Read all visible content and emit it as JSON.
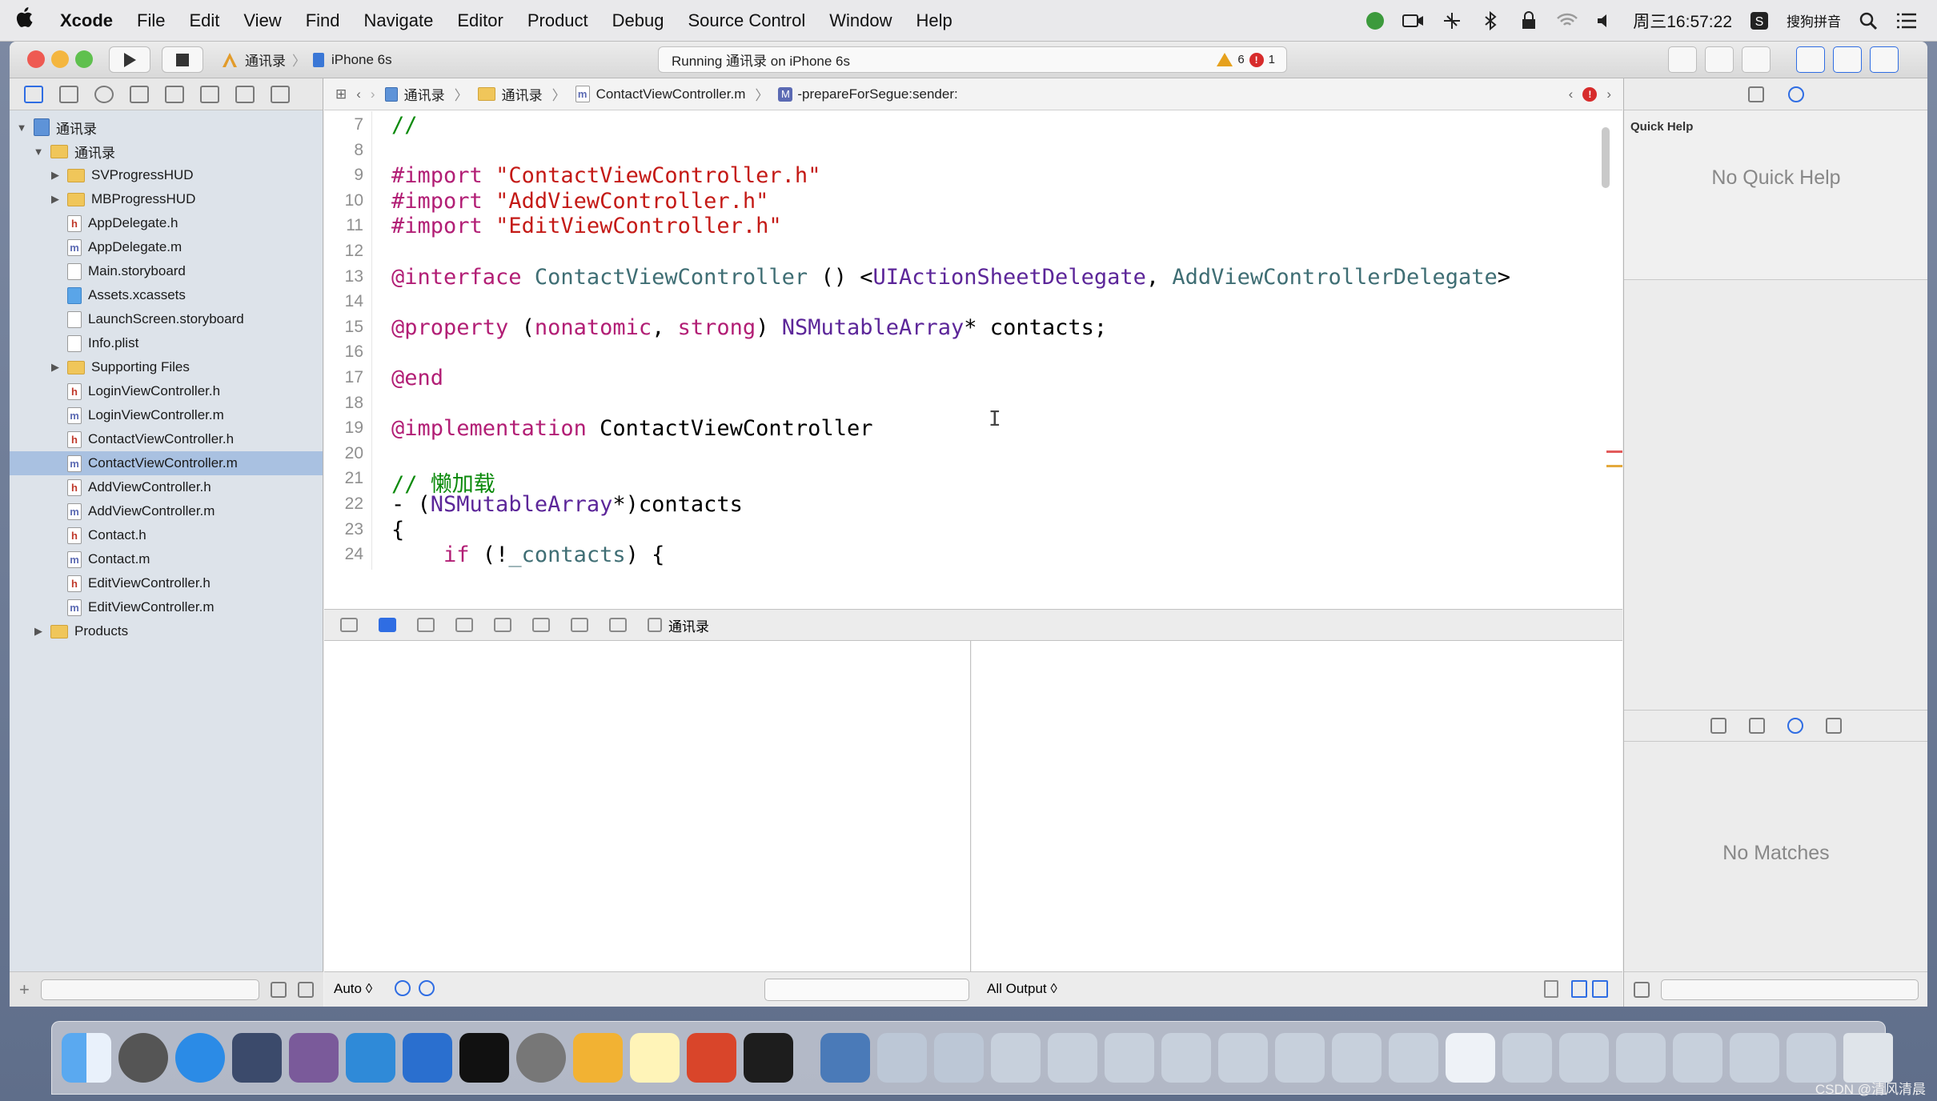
{
  "menubar": {
    "apple": "",
    "app": "Xcode",
    "items": [
      "File",
      "Edit",
      "View",
      "Find",
      "Navigate",
      "Editor",
      "Product",
      "Debug",
      "Source Control",
      "Window",
      "Help"
    ],
    "clock": "周三16:57:22",
    "ime": "搜狗拼音"
  },
  "toolbar": {
    "scheme": "通讯录",
    "device": "iPhone 6s",
    "status": "Running 通讯录 on iPhone 6s",
    "warnings": "6",
    "errors": "1"
  },
  "navigator": {
    "items": [
      {
        "label": "通讯录",
        "kind": "project",
        "depth": 0,
        "disc": "▼"
      },
      {
        "label": "通讯录",
        "kind": "folder",
        "depth": 1,
        "disc": "▼"
      },
      {
        "label": "SVProgressHUD",
        "kind": "folder",
        "depth": 2,
        "disc": "▶"
      },
      {
        "label": "MBProgressHUD",
        "kind": "folder",
        "depth": 2,
        "disc": "▶"
      },
      {
        "label": "AppDelegate.h",
        "kind": "h",
        "depth": 2,
        "disc": ""
      },
      {
        "label": "AppDelegate.m",
        "kind": "m",
        "depth": 2,
        "disc": ""
      },
      {
        "label": "Main.storyboard",
        "kind": "sb",
        "depth": 2,
        "disc": ""
      },
      {
        "label": "Assets.xcassets",
        "kind": "as",
        "depth": 2,
        "disc": ""
      },
      {
        "label": "LaunchScreen.storyboard",
        "kind": "sb",
        "depth": 2,
        "disc": ""
      },
      {
        "label": "Info.plist",
        "kind": "pl",
        "depth": 2,
        "disc": ""
      },
      {
        "label": "Supporting Files",
        "kind": "folder",
        "depth": 2,
        "disc": "▶"
      },
      {
        "label": "LoginViewController.h",
        "kind": "h",
        "depth": 2,
        "disc": ""
      },
      {
        "label": "LoginViewController.m",
        "kind": "m",
        "depth": 2,
        "disc": ""
      },
      {
        "label": "ContactViewController.h",
        "kind": "h",
        "depth": 2,
        "disc": ""
      },
      {
        "label": "ContactViewController.m",
        "kind": "m",
        "depth": 2,
        "disc": "",
        "selected": true
      },
      {
        "label": "AddViewController.h",
        "kind": "h",
        "depth": 2,
        "disc": ""
      },
      {
        "label": "AddViewController.m",
        "kind": "m",
        "depth": 2,
        "disc": ""
      },
      {
        "label": "Contact.h",
        "kind": "h",
        "depth": 2,
        "disc": ""
      },
      {
        "label": "Contact.m",
        "kind": "m",
        "depth": 2,
        "disc": ""
      },
      {
        "label": "EditViewController.h",
        "kind": "h",
        "depth": 2,
        "disc": ""
      },
      {
        "label": "EditViewController.m",
        "kind": "m",
        "depth": 2,
        "disc": ""
      },
      {
        "label": "Products",
        "kind": "folder",
        "depth": 1,
        "disc": "▶"
      }
    ]
  },
  "jumpbar": {
    "c1": "通讯录",
    "c2": "通讯录",
    "c3": "ContactViewController.m",
    "method_badge": "M",
    "c4": "-prepareForSegue:sender:"
  },
  "editor": {
    "lines": [
      {
        "n": "7",
        "html": "<span class='cmt'>//</span>"
      },
      {
        "n": "8",
        "html": ""
      },
      {
        "n": "9",
        "html": "<span class='kw'>#import</span> <span class='str'>\"ContactViewController.h\"</span>"
      },
      {
        "n": "10",
        "html": "<span class='kw'>#import</span> <span class='str'>\"AddViewController.h\"</span>"
      },
      {
        "n": "11",
        "html": "<span class='kw'>#import</span> <span class='str'>\"EditViewController.h\"</span>"
      },
      {
        "n": "12",
        "html": ""
      },
      {
        "n": "13",
        "html": "<span class='kw'>@interface</span> <span class='cls'>ContactViewController</span> () &lt;<span class='prj'>UIActionSheetDelegate</span>, <span class='cls'>AddViewControllerDelegate</span>&gt;"
      },
      {
        "n": "14",
        "html": ""
      },
      {
        "n": "15",
        "html": "<span class='kw'>@property</span> (<span class='kw'>nonatomic</span>, <span class='kw'>strong</span>) <span class='prj'>NSMutableArray</span>* contacts;"
      },
      {
        "n": "16",
        "html": ""
      },
      {
        "n": "17",
        "html": "<span class='kw'>@end</span>"
      },
      {
        "n": "18",
        "html": ""
      },
      {
        "n": "19",
        "html": "<span class='kw'>@implementation</span> ContactViewController"
      },
      {
        "n": "20",
        "html": ""
      },
      {
        "n": "21",
        "html": "<span class='cmt'>// 懒加载</span>"
      },
      {
        "n": "22",
        "html": "- (<span class='prj'>NSMutableArray</span>*)contacts"
      },
      {
        "n": "23",
        "html": "{"
      },
      {
        "n": "24",
        "html": "    <span class='kw'>if</span> (!<span class='cls'>_contacts</span>) {"
      }
    ]
  },
  "debug": {
    "target": "通讯录",
    "auto": "Auto ◊",
    "all_output": "All Output ◊"
  },
  "inspector": {
    "quick_help_title": "Quick Help",
    "no_quick_help": "No Quick Help",
    "no_matches": "No Matches"
  },
  "watermark": "CSDN @清风清晨"
}
